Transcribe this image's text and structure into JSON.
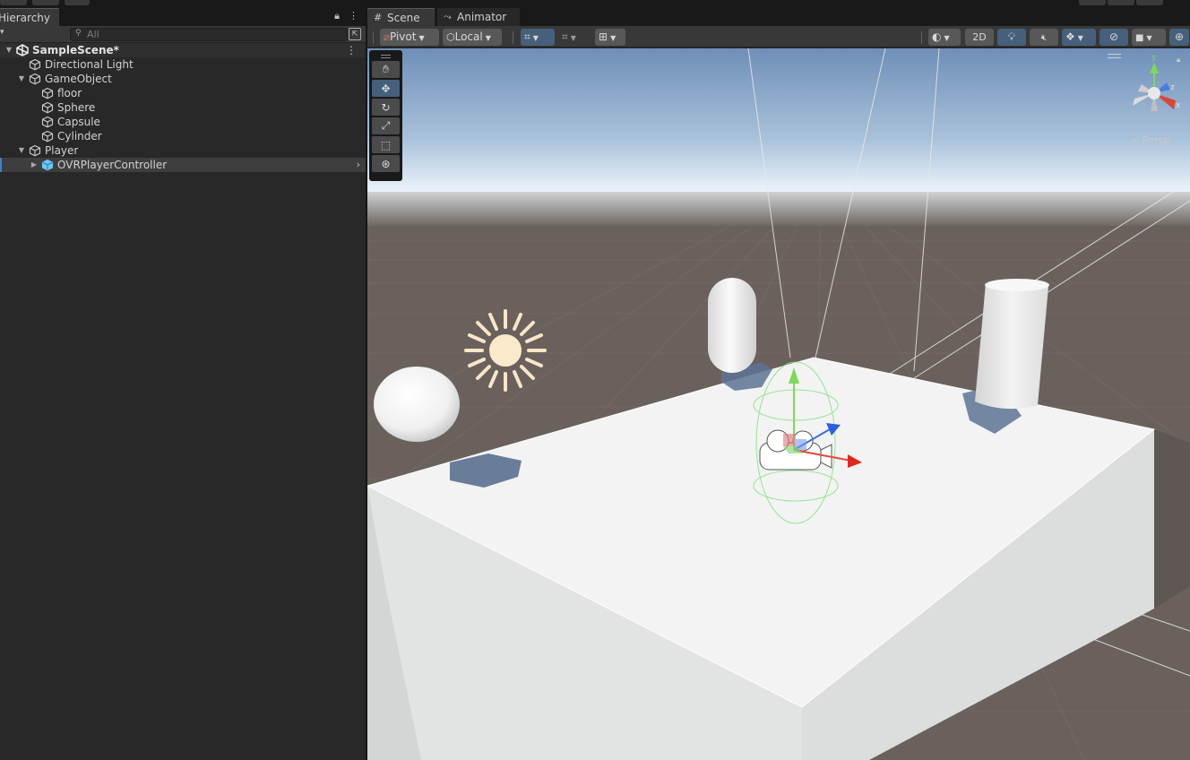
{
  "hierarchy": {
    "tab_label": "Hierarchy",
    "search_placeholder": "All",
    "items": [
      {
        "label": "SampleScene*",
        "depth": 0,
        "fold": "▼",
        "icon": "unity-scene-icon"
      },
      {
        "label": "Directional Light",
        "depth": 1,
        "fold": "",
        "icon": "gameobject-cube-icon"
      },
      {
        "label": "GameObject",
        "depth": 1,
        "fold": "▼",
        "icon": "gameobject-cube-icon"
      },
      {
        "label": "floor",
        "depth": 2,
        "fold": "",
        "icon": "gameobject-cube-icon"
      },
      {
        "label": "Sphere",
        "depth": 2,
        "fold": "",
        "icon": "gameobject-cube-icon"
      },
      {
        "label": "Capsule",
        "depth": 2,
        "fold": "",
        "icon": "gameobject-cube-icon"
      },
      {
        "label": "Cylinder",
        "depth": 2,
        "fold": "",
        "icon": "gameobject-cube-icon"
      },
      {
        "label": "Player",
        "depth": 1,
        "fold": "▼",
        "icon": "gameobject-cube-icon"
      },
      {
        "label": "OVRPlayerController",
        "depth": 2,
        "fold": "▶",
        "icon": "prefab-cube-icon",
        "selected": true
      }
    ]
  },
  "scene_panel": {
    "tabs": [
      {
        "label": "Scene",
        "active": true,
        "icon": "grid-icon"
      },
      {
        "label": "Animator",
        "active": false,
        "icon": "animator-icon"
      }
    ],
    "toolbar": {
      "pivot_label": "Pivot",
      "local_label": "Local",
      "mode_2d_label": "2D"
    },
    "persp_label": "Persp",
    "tools": [
      "hand-tool-icon",
      "move-tool-icon",
      "rotate-tool-icon",
      "scale-tool-icon",
      "rect-tool-icon",
      "transform-tool-icon"
    ],
    "active_tool": "move-tool-icon"
  },
  "colors": {
    "accent": "#46607c",
    "selection": "#3d7fd6",
    "panel_bg": "#282828",
    "toolbar_bg": "#383838"
  }
}
